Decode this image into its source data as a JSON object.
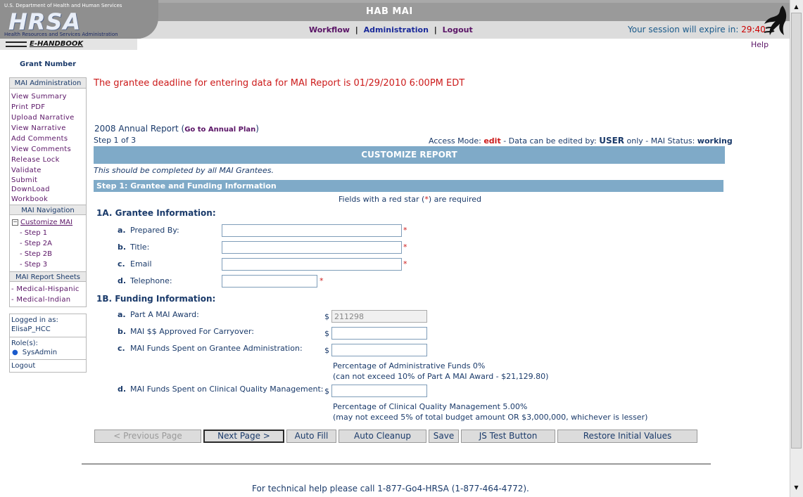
{
  "header": {
    "app_title": "HAB MAI",
    "logo": {
      "dept": "U.S. Department of Health and Human Services",
      "name": "HRSA",
      "subtitle": "Health Resources and Services Administration",
      "ehandbook": "E-HANDBOOK"
    },
    "nav": {
      "workflow": "Workflow",
      "administration": "Administration",
      "logout": "Logout",
      "separator": "|"
    },
    "session_label": "Your session will expire in:",
    "session_timer": "29:40",
    "help": "Help"
  },
  "sidebar": {
    "grant_number_label": "Grant Number",
    "admin_header": "MAI Administration",
    "admin_items": [
      "View Summary",
      "Print PDF",
      "Upload Narrative",
      "View Narrative",
      "Add Comments",
      "View Comments",
      "Release Lock",
      "Validate",
      "Submit",
      "DownLoad",
      "Workbook"
    ],
    "nav_header": "MAI Navigation",
    "tree_toggle": "−",
    "nav_root": "Customize MAI",
    "nav_steps": [
      "- Step 1",
      "- Step 2A",
      "- Step 2B",
      "- Step 3"
    ],
    "sheets_header": "MAI Report Sheets",
    "sheets": [
      "- Medical-Hispanic",
      "- Medical-Indian"
    ],
    "logged_in_label": "Logged in as:",
    "username": "ElisaP_HCC",
    "roles_label": "Role(s):",
    "role_bullet": "●",
    "role": "SysAdmin",
    "logout": "Logout"
  },
  "main": {
    "deadline": "The grantee deadline for entering data for MAI Report is 01/29/2010 6:00PM EDT",
    "report_title": "2008 Annual Report",
    "open_paren": "(",
    "plan_link": "Go to Annual Plan",
    "close_paren": ")",
    "step_of": "Step 1 of 3",
    "access_label": "Access Mode:",
    "access_mode": "edit",
    "access_mid": "- Data can be edited by:",
    "access_user": "USER",
    "access_only": "only - MAI Status:",
    "access_status": "working",
    "customize_bar": "CUSTOMIZE REPORT",
    "should_text": "This should be completed by all MAI Grantees.",
    "step1_bar": "Step 1: Grantee and Funding Information",
    "required_pre": "Fields with a red star (",
    "required_star": "*",
    "required_post": ") are required",
    "section_a": "1A. Grantee Information:",
    "section_b": "1B. Funding Information:",
    "grantee_rows": [
      {
        "letter": "a.",
        "label": "Prepared By:",
        "value": "",
        "required": "*"
      },
      {
        "letter": "b.",
        "label": "Title:",
        "value": "",
        "required": "*"
      },
      {
        "letter": "c.",
        "label": "Email",
        "value": "",
        "required": "*"
      },
      {
        "letter": "d.",
        "label": "Telephone:",
        "value": "",
        "required": "*"
      }
    ],
    "funding_rows": [
      {
        "letter": "a.",
        "label": "Part A MAI Award:",
        "currency": "$",
        "value": "211298"
      },
      {
        "letter": "b.",
        "label": "MAI $$ Approved For Carryover:",
        "currency": "$",
        "value": ""
      },
      {
        "letter": "c.",
        "label": "MAI Funds Spent on Grantee Administration:",
        "currency": "$",
        "value": ""
      },
      {
        "letter": "d.",
        "label": "MAI Funds Spent on Clinical Quality Management:",
        "currency": "$",
        "value": ""
      }
    ],
    "admin_note_1": "Percentage of Administrative Funds 0%",
    "admin_note_2": "(can not exceed 10% of Part A MAI Award - $21,129.80)",
    "cqm_note_1": "Percentage of Clinical Quality Management 5.00%",
    "cqm_note_2": "(may not exceed 5% of total budget amount OR $3,000,000, whichever is lesser)"
  },
  "buttons": {
    "previous": "< Previous Page",
    "next": "Next Page >",
    "auto_fill": "Auto Fill",
    "auto_cleanup": "Auto Cleanup",
    "save": "Save",
    "js_test": "JS Test Button",
    "restore": "Restore Initial Values"
  },
  "footer": {
    "help_text": "For technical help please call 1-877-Go4-HRSA (1-877-464-4772)."
  },
  "scrollbar": {
    "up": "▲",
    "down": "▼"
  },
  "colors": {
    "accent_bar": "#7faac8",
    "link_purple": "#5a1466",
    "link_blue": "#1a2a9a",
    "alert_red": "#cc1a1a",
    "text_navy": "#1a3a6a"
  }
}
